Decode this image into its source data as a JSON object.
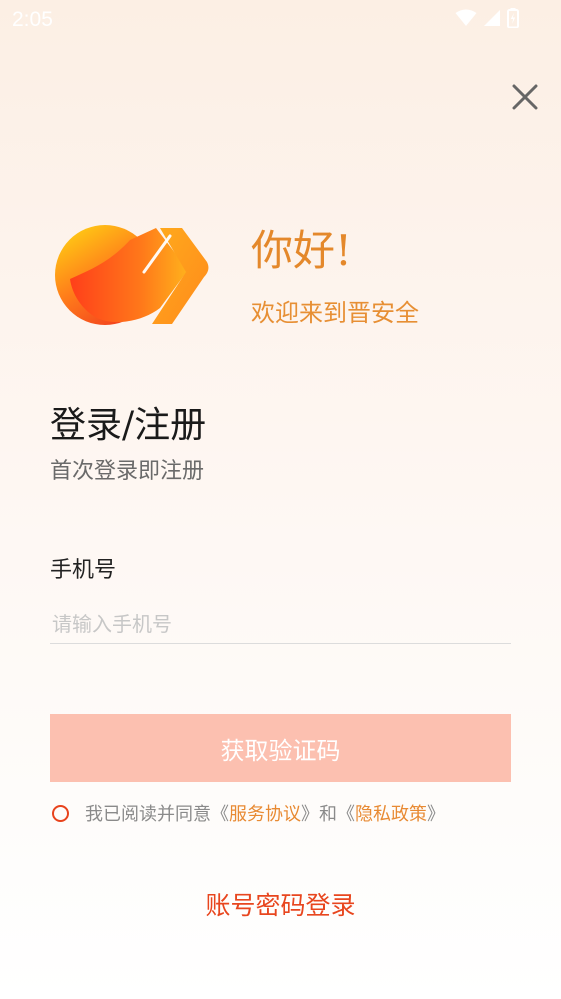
{
  "status_bar": {
    "time": "2:05",
    "icons": [
      "wifi-icon",
      "signal-icon",
      "battery-icon"
    ]
  },
  "header": {
    "close_icon": "close-icon"
  },
  "brand": {
    "greeting": "你好!",
    "welcome": "欢迎来到晋安全"
  },
  "login": {
    "title": "登录/注册",
    "subtitle": "首次登录即注册",
    "phone_label": "手机号",
    "phone_value": "",
    "phone_placeholder": "请输入手机号",
    "get_code_label": "获取验证码",
    "agreement": {
      "prefix": "我已阅读并同意《",
      "service_link": "服务协议",
      "middle": "》和《",
      "privacy_link": "隐私政策",
      "suffix": "》"
    },
    "password_login_label": "账号密码登录"
  },
  "colors": {
    "accent": "#e8461e",
    "brand_orange": "#e4882b",
    "button_disabled": "#fcc0b0",
    "link": "#e88a33"
  }
}
